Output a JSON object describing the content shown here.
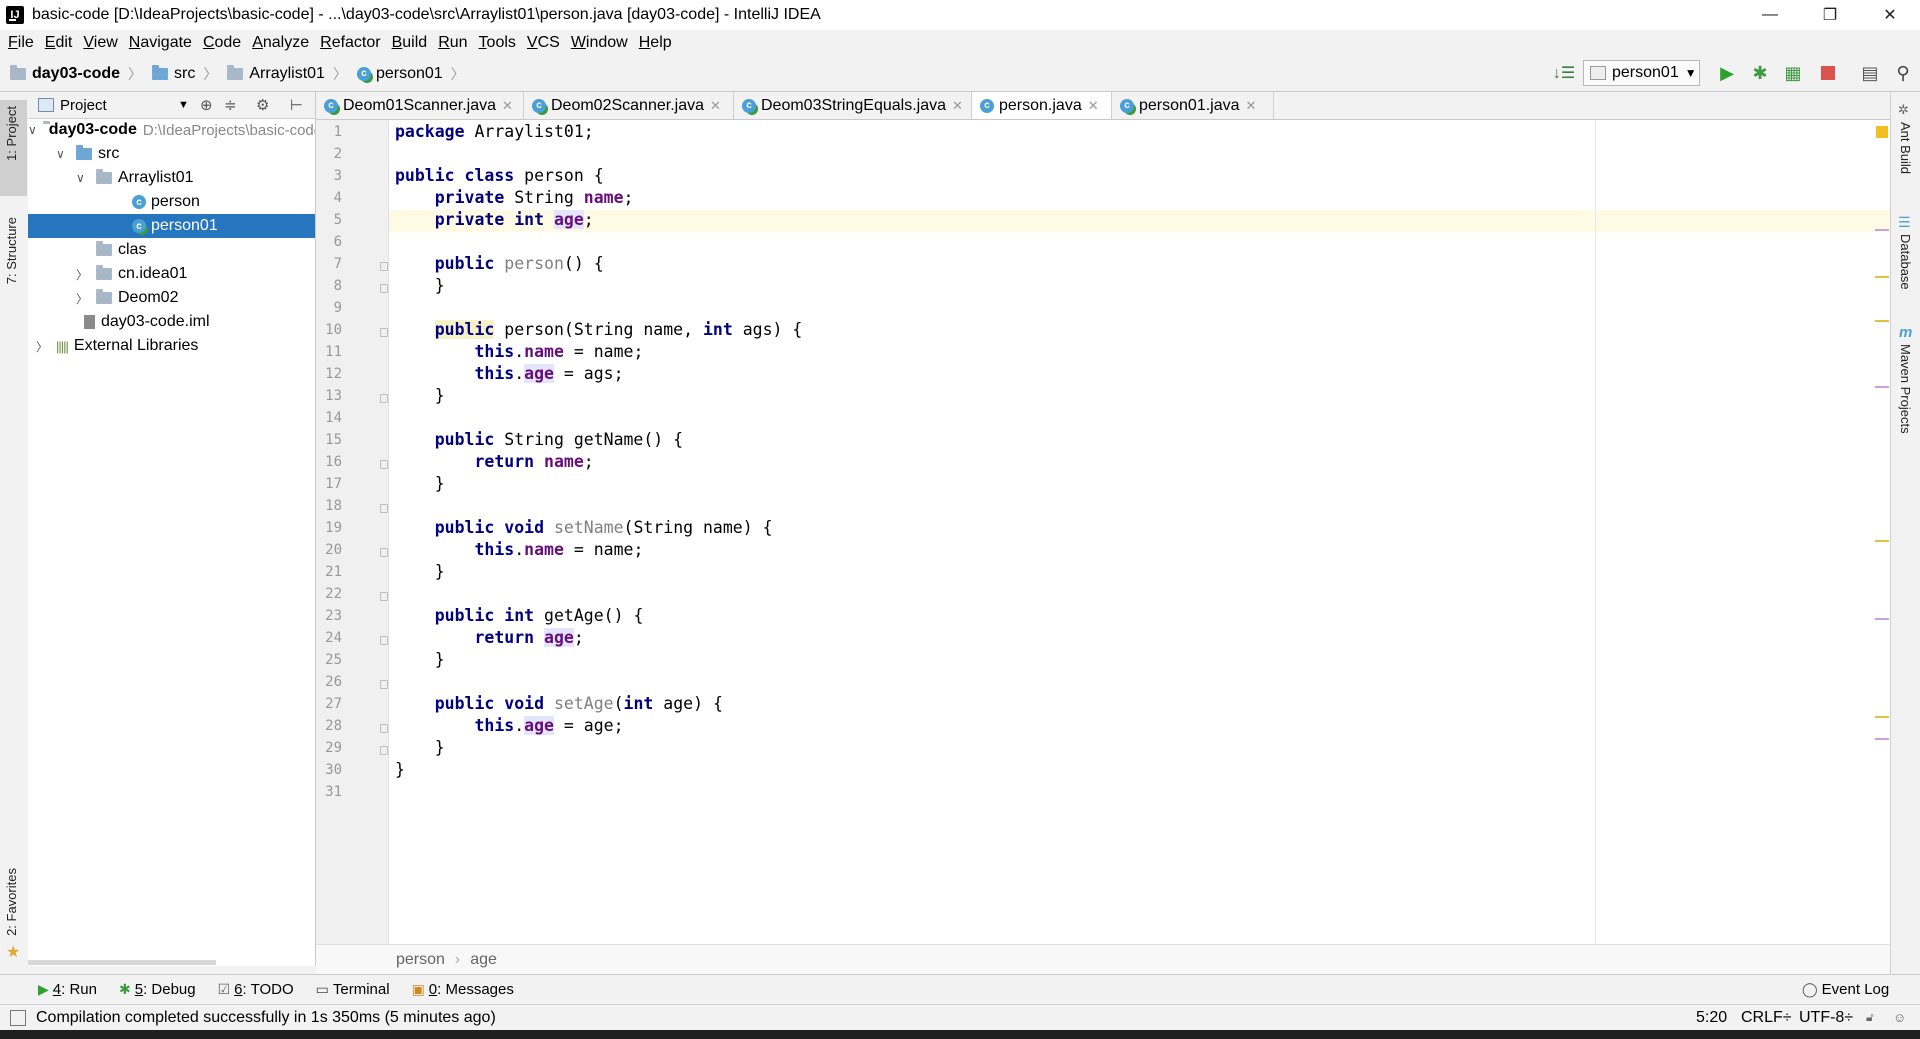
{
  "window": {
    "title": "basic-code [D:\\IdeaProjects\\basic-code] - ...\\day03-code\\src\\Arraylist01\\person.java [day03-code] - IntelliJ IDEA",
    "minimize": "—",
    "restore": "❐",
    "close": "✕"
  },
  "menu": [
    "File",
    "Edit",
    "View",
    "Navigate",
    "Code",
    "Analyze",
    "Refactor",
    "Build",
    "Run",
    "Tools",
    "VCS",
    "Window",
    "Help"
  ],
  "nav": {
    "crumbs": [
      "day03-code",
      "src",
      "Arraylist01",
      "person01"
    ],
    "run_config": "person01"
  },
  "left_tabs": {
    "project": "1: Project",
    "structure": "7: Structure",
    "favorites": "2: Favorites"
  },
  "project_panel": {
    "title": "Project",
    "tree": [
      {
        "label": "day03-code",
        "extra": "D:\\IdeaProjects\\basic-code",
        "arrow": "v"
      },
      {
        "label": "src",
        "arrow": "v"
      },
      {
        "label": "Arraylist01",
        "arrow": "v"
      },
      {
        "label": "person",
        "arrow": ""
      },
      {
        "label": "person01",
        "arrow": ""
      },
      {
        "label": "clas",
        "arrow": ""
      },
      {
        "label": "cn.idea01",
        "arrow": ">"
      },
      {
        "label": "Deom02",
        "arrow": ">"
      },
      {
        "label": "day03-code.iml",
        "arrow": ""
      },
      {
        "label": "External Libraries",
        "arrow": ">"
      }
    ]
  },
  "tabs": [
    "Deom01Scanner.java",
    "Deom02Scanner.java",
    "Deom03StringEquals.java",
    "person.java",
    "person01.java"
  ],
  "line_numbers": [
    "1",
    "2",
    "3",
    "4",
    "5",
    "6",
    "7",
    "8",
    "9",
    "10",
    "11",
    "12",
    "13",
    "14",
    "15",
    "16",
    "17",
    "18",
    "19",
    "20",
    "21",
    "22",
    "23",
    "24",
    "25",
    "26",
    "27",
    "28",
    "29",
    "30",
    "31"
  ],
  "code": {
    "package_kw": "package",
    "package_name": " Arraylist01;",
    "public": "public",
    "class": "class",
    "private": "private",
    "int": "int",
    "void": "void",
    "this": "this",
    "return": "return",
    "class_name": " person {",
    "string_type": " String ",
    "name": "name",
    "age": "age",
    "semi": ";",
    "ctor_name": "person",
    "ctor_empty": "() {",
    "ctor_params_a": " person(String name, ",
    "ctor_params_b": " ags) {",
    "close_brace": "}",
    "assign_name": " = name;",
    "assign_ags": " = ags;",
    "assign_age": " = age;",
    "dot": ".",
    "get_name": " String getName() {",
    "set_name": "setName",
    "set_name_params": "(String name) {",
    "get_age": " getAge() {",
    "set_age": "setAge",
    "set_age_params_a": "(",
    "set_age_params_b": " age) {"
  },
  "editor_breadcrumb": [
    "person",
    "age"
  ],
  "right_tabs": {
    "ant": "Ant Build",
    "database": "Database",
    "maven": "Maven Projects"
  },
  "toolwindows": [
    {
      "num": "4",
      "label": ": Run"
    },
    {
      "num": "5",
      "label": ": Debug"
    },
    {
      "num": "6",
      "label": ": TODO"
    },
    {
      "num": "",
      "label": "Terminal"
    },
    {
      "num": "0",
      "label": ": Messages"
    }
  ],
  "event_log": "Event Log",
  "status": {
    "message": "Compilation completed successfully in 1s 350ms (5 minutes ago)",
    "position": "5:20",
    "line_sep": "CRLF÷",
    "encoding": "UTF-8÷"
  },
  "colors": {
    "keyword": "#000080",
    "field": "#660e7a",
    "selection": "#2675bf",
    "run": "#3d9a3d"
  }
}
